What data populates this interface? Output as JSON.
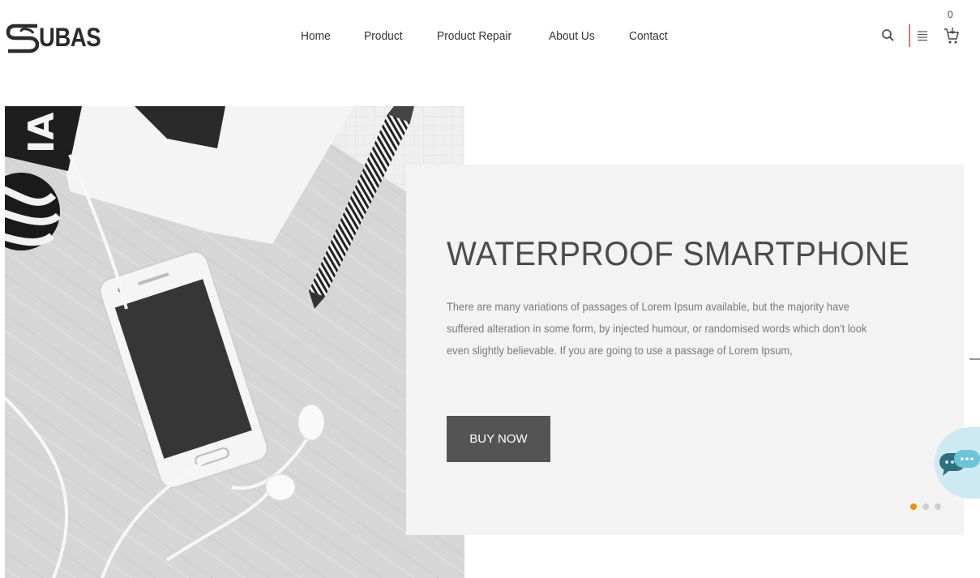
{
  "brand": {
    "logo_text": "UBAS"
  },
  "nav": {
    "items": [
      {
        "label": "Home"
      },
      {
        "label": "Product"
      },
      {
        "label": "Product Repair"
      },
      {
        "label": "About Us"
      },
      {
        "label": "Contact"
      }
    ]
  },
  "tools": {
    "search_icon": "search-icon",
    "menu_icon": "list-icon",
    "cart_icon": "cart-icon",
    "cart_count": "0"
  },
  "hero": {
    "title": "WATERPROOF SMARTPHONE",
    "description": "There are many variations of passages of Lorem Ipsum available, but the majority have suffered alteration in some form, by injected humour, or randomised words which don't look even slightly believable. If you are going to use a passage of Lorem Ipsum,",
    "button_label": "BUY NOW",
    "slides_total": 3,
    "slide_active": 1
  },
  "colors": {
    "accent": "#f29100",
    "button": "#545454",
    "divider": "#e74c3c",
    "chat": "#cde9f1"
  }
}
